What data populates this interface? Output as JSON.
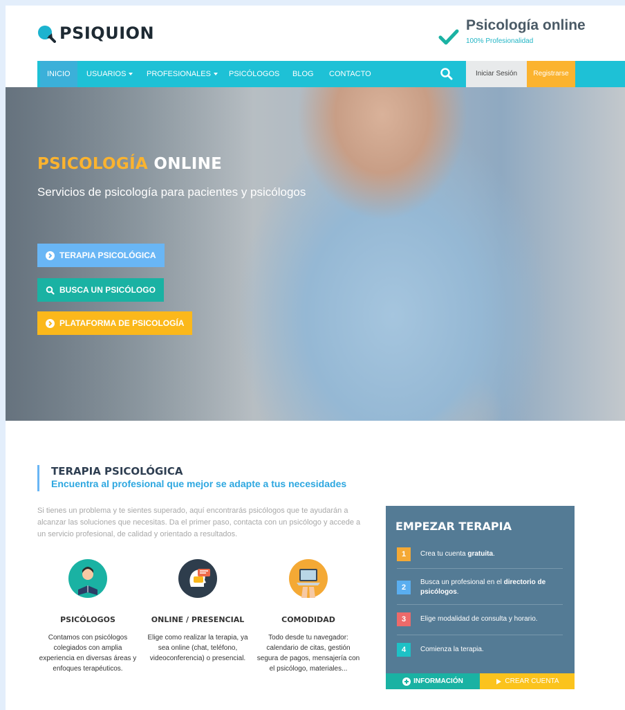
{
  "brand": {
    "name": "PSIQUION",
    "tagline_title": "Psicología online",
    "tagline_sub": "100% Profesionalidad"
  },
  "nav": {
    "items": [
      "INICIO",
      "USUARIOS",
      "PROFESIONALES",
      "PSICÓLOGOS",
      "BLOG",
      "CONTACTO"
    ],
    "login": "Iniciar Sesión",
    "register": "Registrarse"
  },
  "hero": {
    "title_highlight": "PSICOLOGÍA",
    "title_rest": "ONLINE",
    "subtitle": "Servicios de psicología para pacientes y psicólogos",
    "buttons": [
      "TERAPIA PSICOLÓGICA",
      "BUSCA UN PSICÓLOGO",
      "PLATAFORMA DE PSICOLOGÍA"
    ]
  },
  "section": {
    "title": "TERAPIA PSICOLÓGICA",
    "subtitle": "Encuentra al profesional que mejor se adapte a tus necesidades",
    "text": "Si tienes un problema y te sientes superado, aquí encontrarás psicólogos que te ayudarán a alcanzar las soluciones que necesitas. Da el primer paso, contacta con un psicólogo y accede a un servicio profesional, de calidad y orientado a resultados."
  },
  "features": [
    {
      "title": "PSICÓLOGOS",
      "text": "Contamos con psicólogos colegiados con amplia experiencia en diversas áreas y enfoques terapéuticos."
    },
    {
      "title": "ONLINE / PRESENCIAL",
      "text": "Elige como realizar la terapia, ya sea online (chat, teléfono, videoconferencia) o presencial."
    },
    {
      "title": "COMODIDAD",
      "text": "Todo desde tu navegador: calendario de citas, gestión segura de pagos, mensajería con el psicólogo, materiales..."
    }
  ],
  "steps_box": {
    "title": "EMPEZAR TERAPIA",
    "steps": [
      {
        "num": "1",
        "pre": "Crea tu cuenta ",
        "bold": "gratuita",
        "post": ".",
        "color": "#f4a935"
      },
      {
        "num": "2",
        "pre": "Busca un profesional en el ",
        "bold": "directorio de psicólogos",
        "post": ".",
        "color": "#5aaef0"
      },
      {
        "num": "3",
        "pre": "Elige modalidad de consulta y horario.",
        "bold": "",
        "post": "",
        "color": "#ee6a6a"
      },
      {
        "num": "4",
        "pre": "Comienza la terapia.",
        "bold": "",
        "post": "",
        "color": "#1ec1c6"
      }
    ],
    "info_label": "INFORMACIÓN",
    "create_label": "CREAR CUENTA"
  },
  "colors": {
    "nav": "#1ec1d6",
    "accent_orange": "#fbb32f",
    "teal": "#1ab2a3",
    "blue": "#69b6f5",
    "box": "#547b95"
  }
}
